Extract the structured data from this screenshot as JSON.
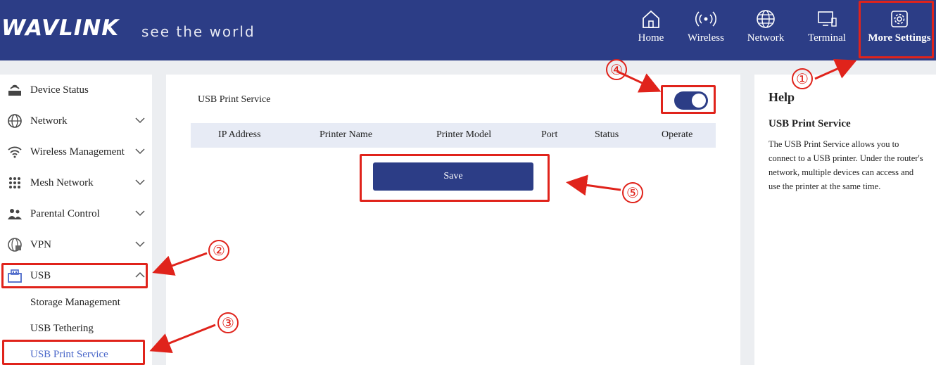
{
  "header": {
    "logo": "WAVLINK",
    "tagline": "see the world",
    "nav": [
      {
        "label": "Home",
        "icon": "home-icon"
      },
      {
        "label": "Wireless",
        "icon": "wireless-icon"
      },
      {
        "label": "Network",
        "icon": "globe-icon"
      },
      {
        "label": "Terminal",
        "icon": "terminal-icon"
      },
      {
        "label": "More Settings",
        "icon": "gear-icon"
      }
    ]
  },
  "sidebar": {
    "items": [
      {
        "label": "Device Status"
      },
      {
        "label": "Network"
      },
      {
        "label": "Wireless Management"
      },
      {
        "label": "Mesh Network"
      },
      {
        "label": "Parental Control"
      },
      {
        "label": "VPN"
      },
      {
        "label": "USB"
      }
    ],
    "sub_items": [
      {
        "label": "Storage Management"
      },
      {
        "label": "USB Tethering"
      },
      {
        "label": "USB Print Service"
      }
    ]
  },
  "main": {
    "service_label": "USB Print Service",
    "toggle_on": true,
    "columns": [
      "IP Address",
      "Printer Name",
      "Printer Model",
      "Port",
      "Status",
      "Operate"
    ],
    "save_label": "Save"
  },
  "help": {
    "title": "Help",
    "subtitle": "USB Print Service",
    "text": "The USB Print Service allows you to connect to a USB printer. Under the router's network, multiple devices can access and use the printer at the same time."
  },
  "annotations": [
    "①",
    "②",
    "③",
    "④",
    "⑤"
  ],
  "colors": {
    "header": "#2c3d86",
    "accent": "#4a67c9",
    "annotation": "#e0231b"
  }
}
